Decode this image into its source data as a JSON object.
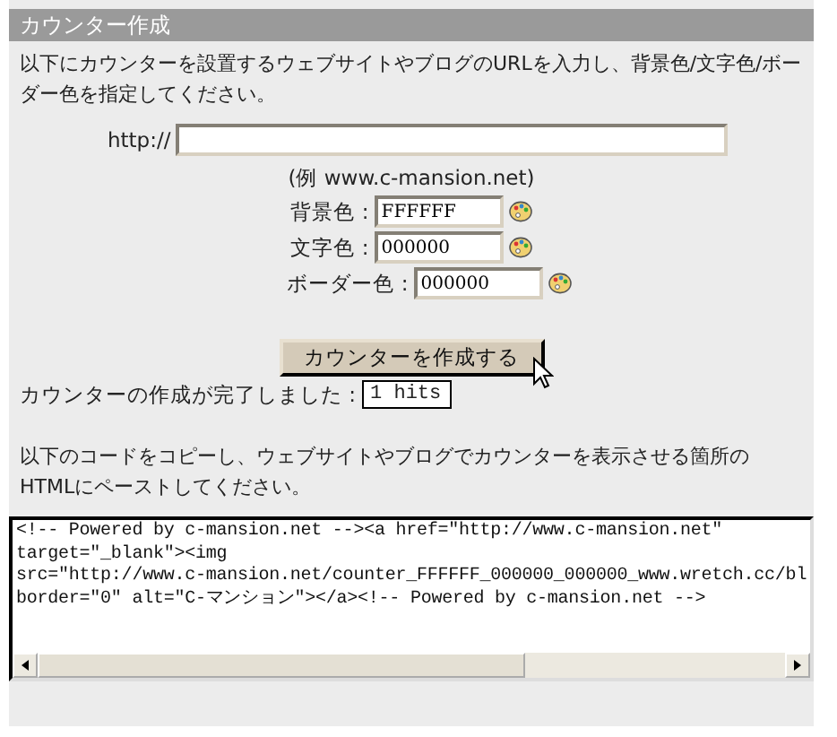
{
  "header": {
    "title": "カウンター作成"
  },
  "intro": "以下にカウンターを設置するウェブサイトやブログのURLを入力し、背景色/文字色/ボーダー色を指定してください。",
  "url_field": {
    "label": "http://"
  },
  "example": "(例 www.c-mansion.net)",
  "colors": [
    {
      "label": "背景色 :",
      "value": "FFFFFF"
    },
    {
      "label": "文字色 :",
      "value": "000000"
    },
    {
      "label": "ボーダー色 :",
      "value": "000000"
    }
  ],
  "create_button": {
    "label": "カウンターを作成する"
  },
  "result": {
    "label": "カウンターの作成が完了しました :",
    "preview": "1 hits"
  },
  "instruction": "以下のコードをコピーし、ウェブサイトやブログでカウンターを表示させる箇所のHTMLにペーストしてください。",
  "code_lines": [
    "<!-- Powered by c-mansion.net --><a href=\"http://www.c-mansion.net\"",
    "target=\"_blank\"><img",
    "src=\"http://www.c-mansion.net/counter_FFFFFF_000000_000000_www.wretch.cc/bl",
    "border=\"0\" alt=\"C-マンション\"></a><!-- Powered by c-mansion.net -->"
  ]
}
